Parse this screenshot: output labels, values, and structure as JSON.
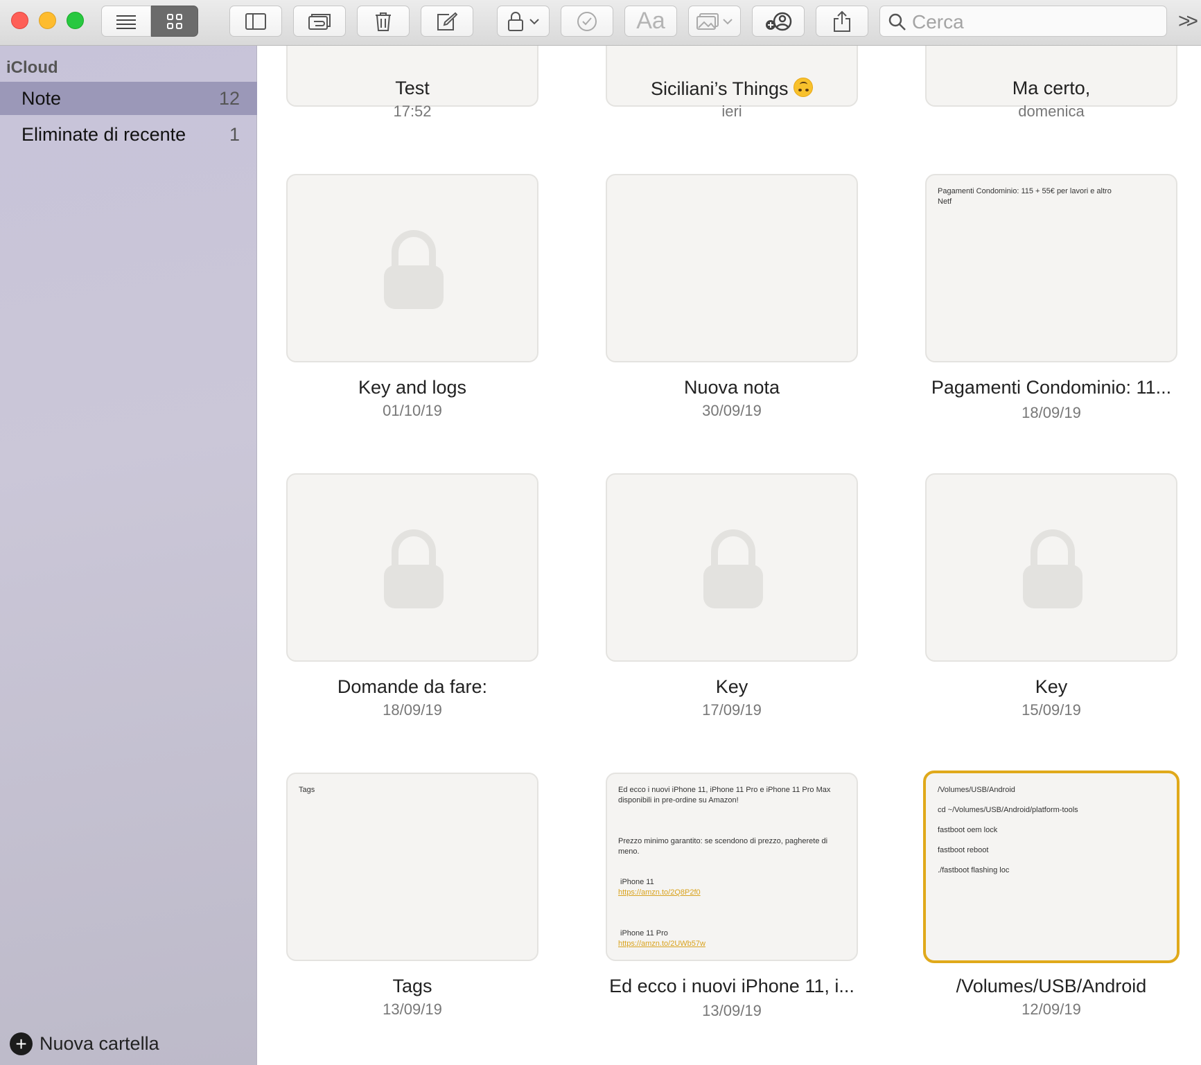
{
  "toolbar": {
    "search_placeholder": "Cerca",
    "font_button_label": "Aa",
    "overflow_label": ">>"
  },
  "sidebar": {
    "heading": "iCloud",
    "items": [
      {
        "label": "Note",
        "count": "12",
        "selected": true
      },
      {
        "label": "Eliminate di recente",
        "count": "1",
        "selected": false
      }
    ],
    "new_folder_label": "Nuova cartella"
  },
  "notes": [
    {
      "title": "Test",
      "date": "17:52"
    },
    {
      "title": "Siciliani’s Things",
      "date": "ieri",
      "emoji_icon": "upside-down-face-icon"
    },
    {
      "title": "Ma certo,",
      "date": "domenica"
    },
    {
      "title": "Key and logs",
      "date": "01/10/19",
      "locked": true
    },
    {
      "title": "Nuova nota",
      "date": "30/09/19"
    },
    {
      "title": "Pagamenti Condominio: 11...",
      "date": "18/09/19",
      "preview": [
        "Pagamenti Condominio: 115 + 55€ per lavori e altro",
        "Netf"
      ]
    },
    {
      "title": "Domande da fare:",
      "date": "18/09/19",
      "locked": true
    },
    {
      "title": "Key",
      "date": "17/09/19",
      "locked": true
    },
    {
      "title": "Key",
      "date": "15/09/19",
      "locked": true
    },
    {
      "title": "Tags",
      "date": "13/09/19",
      "preview": [
        "Tags"
      ]
    },
    {
      "title": "Ed ecco i nuovi iPhone 11, i...",
      "date": "13/09/19",
      "preview": [
        "Ed ecco i nuovi iPhone 11, iPhone 11 Pro e iPhone 11 Pro Max disponibili in pre-ordine su Amazon!",
        " Prezzo minimo garantito: se scendono di prezzo, pagherete di meno.",
        "iPhone 11",
        "https://amzn.to/2Q8P2f0",
        "iPhone 11 Pro",
        "https://amzn.to/2UWb57w"
      ]
    },
    {
      "title": "/Volumes/USB/Android",
      "date": "12/09/19",
      "selected": true,
      "preview": [
        "/Volumes/USB/Android",
        "cd ~/Volumes/USB/Android/platform-tools",
        "fastboot oem lock",
        "fastboot reboot",
        "./fastboot flashing loc"
      ]
    }
  ],
  "colors": {
    "accent_selection": "#e0a91b",
    "sidebar_selected": "#9b98b8",
    "link": "#d9a21d"
  }
}
